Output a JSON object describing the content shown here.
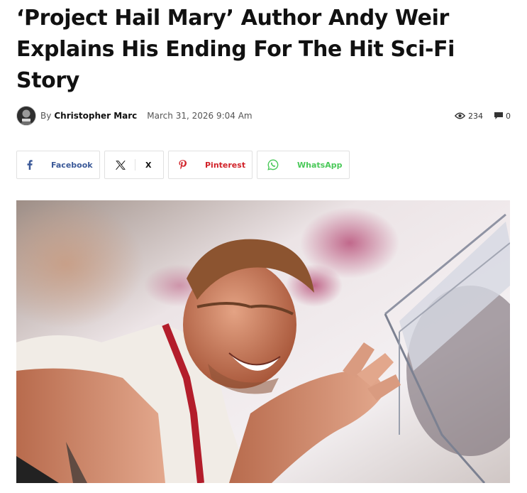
{
  "article": {
    "title": "‘Project Hail Mary’ Author Andy Weir Explains His Ending For The Hit Sci-Fi Story"
  },
  "meta": {
    "by": "By",
    "author": "Christopher Marc",
    "date": "March 31, 2026 9:04 Am",
    "views": "234",
    "comments": "0",
    "views_icon": "eye-icon",
    "comments_icon": "comment-icon"
  },
  "share": {
    "facebook": {
      "label": "Facebook",
      "icon": "facebook-icon",
      "color": "#3b5998"
    },
    "x": {
      "label": "X",
      "icon": "x-icon",
      "color": "#111111"
    },
    "pinterest": {
      "label": "Pinterest",
      "icon": "pinterest-icon",
      "color": "#d12229"
    },
    "whatsapp": {
      "label": "WhatsApp",
      "icon": "whatsapp-icon",
      "color": "#4ac959"
    }
  }
}
